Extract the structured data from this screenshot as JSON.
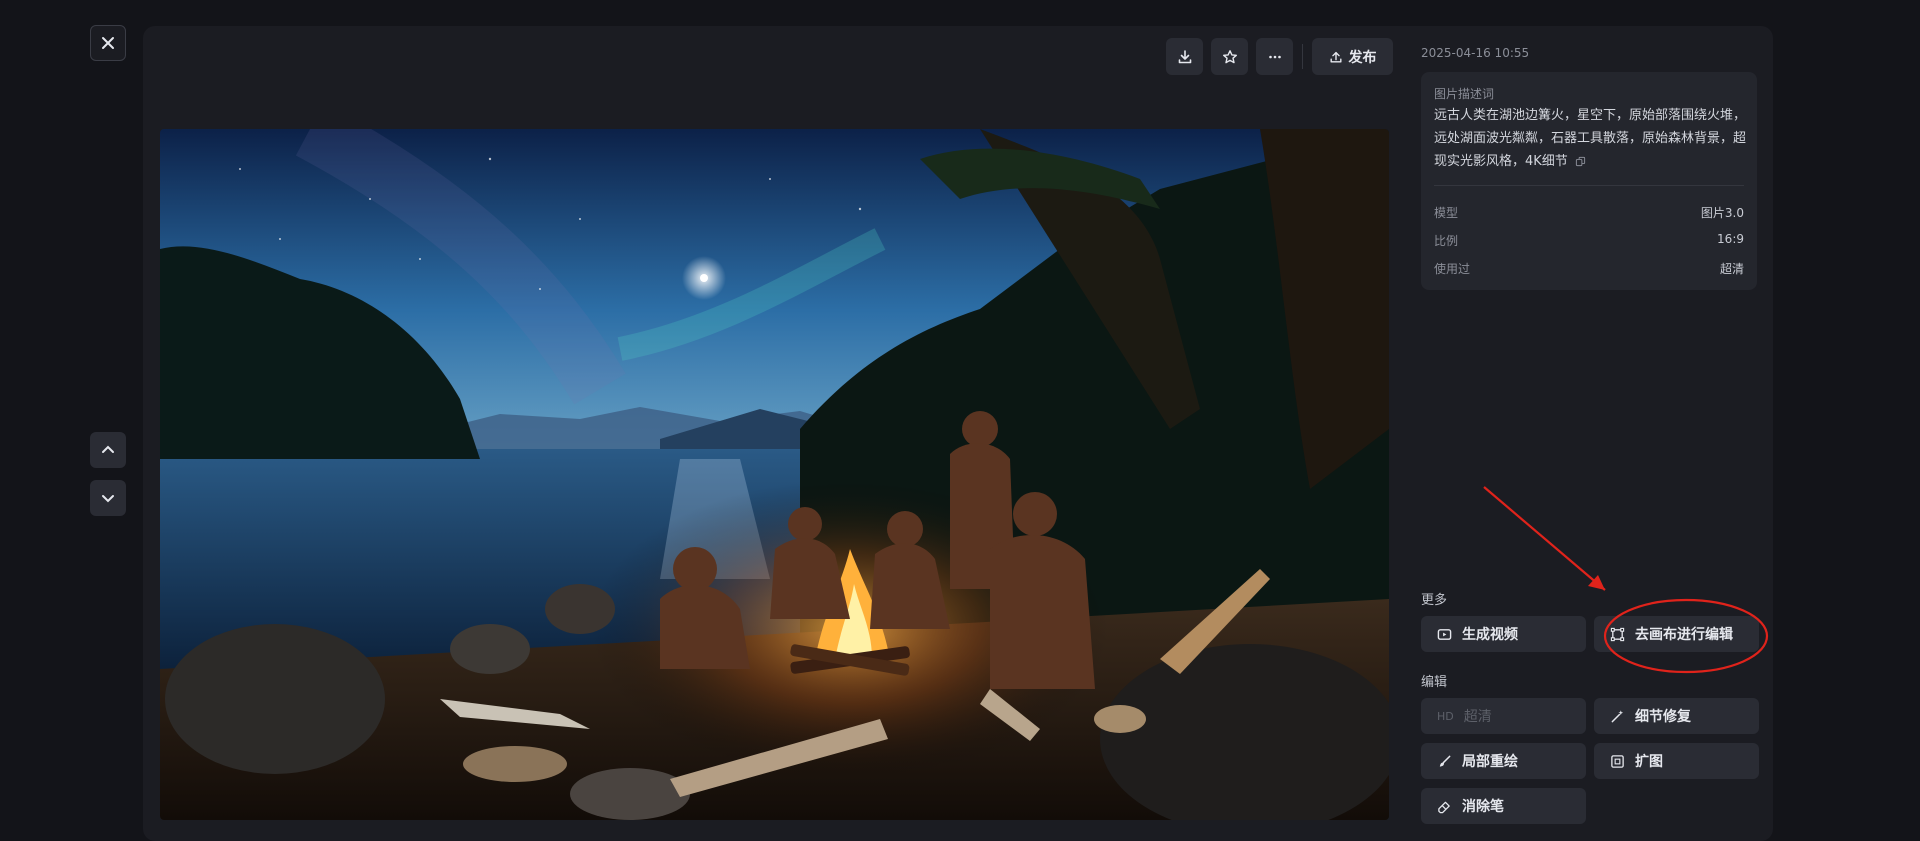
{
  "toolbar": {
    "download_icon": "download-icon",
    "star_icon": "star-icon",
    "more_icon": "more-icon",
    "publish_label": "发布"
  },
  "nav": {
    "close_icon": "close-icon",
    "up_icon": "chevron-up-icon",
    "down_icon": "chevron-down-icon"
  },
  "info": {
    "timestamp": "2025-04-16 10:55",
    "desc_title": "图片描述词",
    "desc_text": "远古人类在湖池边篝火，星空下，原始部落围绕火堆，远处湖面波光粼粼，石器工具散落，原始森林背景，超现实光影风格，4K细节",
    "meta": [
      {
        "key": "模型",
        "value": "图片3.0"
      },
      {
        "key": "比例",
        "value": "16:9"
      },
      {
        "key": "使用过",
        "value": "超清"
      }
    ]
  },
  "more_section": {
    "label": "更多",
    "generate_video": "生成视频",
    "canvas_edit": "去画布进行编辑"
  },
  "edit_section": {
    "label": "编辑",
    "hd_badge": "HD",
    "hd_label": "超清",
    "detail_fix": "细节修复",
    "inpaint": "局部重绘",
    "expand": "扩图",
    "eraser": "消除笔"
  },
  "colors": {
    "background": "#131419",
    "panel": "#1b1c22",
    "button": "#2a2c34",
    "annotation": "#e0231b"
  }
}
